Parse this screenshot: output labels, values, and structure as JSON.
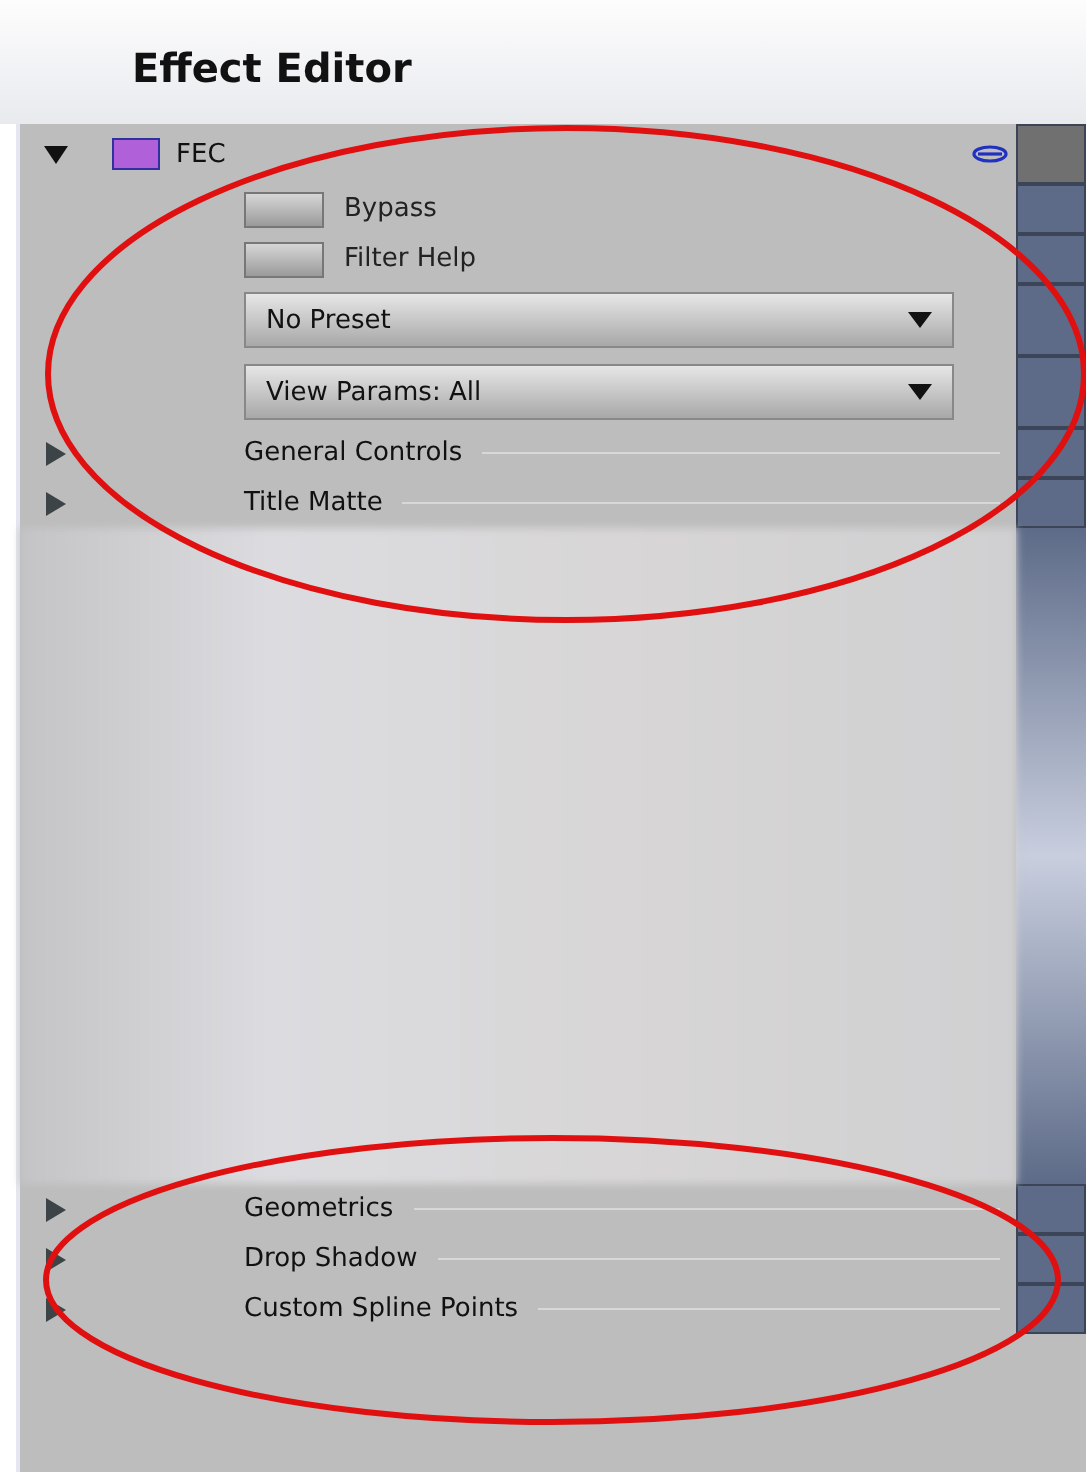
{
  "window": {
    "title": "Effect Editor"
  },
  "effect": {
    "name": "FEC",
    "expanded": true
  },
  "buttons": [
    {
      "label": "Bypass"
    },
    {
      "label": "Filter Help"
    }
  ],
  "dropdowns": [
    {
      "label": "No Preset"
    },
    {
      "label": "View Params: All"
    }
  ],
  "sections_top": [
    {
      "label": "General Controls",
      "expanded": false
    },
    {
      "label": "Title Matte",
      "expanded": false
    }
  ],
  "sections_bottom": [
    {
      "label": "Geometrics",
      "expanded": false
    },
    {
      "label": "Drop  Shadow",
      "expanded": false
    },
    {
      "label": "Custom Spline Points",
      "expanded": false
    }
  ]
}
